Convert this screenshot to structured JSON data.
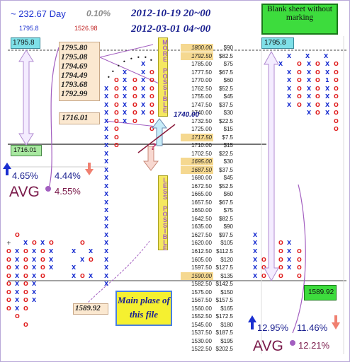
{
  "header": {
    "day_change": "~ 232.67 Day",
    "pct": "0.10%",
    "date1": "2012-10-19 20~00",
    "date2": "2012-03-01 04~00",
    "sub_left": "1795.8",
    "sub_mid": "1526.98",
    "blank_sheet": "Blank sheet without marking"
  },
  "left_panel": {
    "top_level": "1795.8",
    "mid_level": "1716.01",
    "pct_up": "4.65%",
    "pct_down": "4.44%",
    "avg_label": "AVG",
    "avg_value": "4.55%",
    "price_list": [
      "1795.80",
      "1795.08",
      "1794.69",
      "1794.49",
      "1793.68",
      "1792.99"
    ],
    "price_single": "1716.01",
    "low_price": "1589.92"
  },
  "center": {
    "more_possible": "MORE POSSIBLE",
    "less_possible": "LESS POSSIBLE",
    "current_price": "1740.00",
    "question_mark": "?",
    "main_place": "Main plase of this file"
  },
  "right_panel": {
    "top_level": "1795.8",
    "low_level": "1589.92",
    "pct_up": "12.95%",
    "pct_down": "11.46%",
    "avg_label": "AVG",
    "avg_value": "12.21%"
  },
  "colors": {
    "x_color": "#1a2fd0",
    "o_color": "#e02020",
    "highlight": "#f5d890",
    "cyan_box": "#7fe0e8",
    "green_box": "#3ddc3d",
    "purple": "#a35fc0"
  },
  "chart_data": {
    "type": "table",
    "levels": [
      {
        "price": "1800.00",
        "diff": "$90",
        "hl": true
      },
      {
        "price": "1792.50",
        "diff": "$82.5",
        "hl": true
      },
      {
        "price": "1785.00",
        "diff": "$75",
        "hl": false
      },
      {
        "price": "1777.50",
        "diff": "$67.5",
        "hl": false
      },
      {
        "price": "1770.00",
        "diff": "$60",
        "hl": false
      },
      {
        "price": "1762.50",
        "diff": "$52.5",
        "hl": false
      },
      {
        "price": "1755.00",
        "diff": "$45",
        "hl": false
      },
      {
        "price": "1747.50",
        "diff": "$37.5",
        "hl": false
      },
      {
        "price": "1740.00",
        "diff": "$30",
        "hl": false
      },
      {
        "price": "1732.50",
        "diff": "$22.5",
        "hl": false
      },
      {
        "price": "1725.00",
        "diff": "$15",
        "hl": false
      },
      {
        "price": "1717.50",
        "diff": "$7.5",
        "hl": true
      },
      {
        "price": "1710.00",
        "diff": "$15",
        "hl": false
      },
      {
        "price": "1702.50",
        "diff": "$22.5",
        "hl": false
      },
      {
        "price": "1695.00",
        "diff": "$30",
        "hl": true
      },
      {
        "price": "1687.50",
        "diff": "$37.5",
        "hl": true
      },
      {
        "price": "1680.00",
        "diff": "$45",
        "hl": false
      },
      {
        "price": "1672.50",
        "diff": "$52.5",
        "hl": false
      },
      {
        "price": "1665.00",
        "diff": "$60",
        "hl": false
      },
      {
        "price": "1657.50",
        "diff": "$67.5",
        "hl": false
      },
      {
        "price": "1650.00",
        "diff": "$75",
        "hl": false
      },
      {
        "price": "1642.50",
        "diff": "$82.5",
        "hl": false
      },
      {
        "price": "1635.00",
        "diff": "$90",
        "hl": false
      },
      {
        "price": "1627.50",
        "diff": "$97.5",
        "hl": false
      },
      {
        "price": "1620.00",
        "diff": "$105",
        "hl": false
      },
      {
        "price": "1612.50",
        "diff": "$112.5",
        "hl": false
      },
      {
        "price": "1605.00",
        "diff": "$120",
        "hl": false
      },
      {
        "price": "1597.50",
        "diff": "$127.5",
        "hl": false
      },
      {
        "price": "1590.00",
        "diff": "$135",
        "hl": true
      },
      {
        "price": "1582.50",
        "diff": "$142.5",
        "hl": false
      },
      {
        "price": "1575.00",
        "diff": "$150",
        "hl": false
      },
      {
        "price": "1567.50",
        "diff": "$157.5",
        "hl": false
      },
      {
        "price": "1560.00",
        "diff": "$165",
        "hl": false
      },
      {
        "price": "1552.50",
        "diff": "$172.5",
        "hl": false
      },
      {
        "price": "1545.00",
        "diff": "$180",
        "hl": false
      },
      {
        "price": "1537.50",
        "diff": "$187.5",
        "hl": false
      },
      {
        "price": "1530.00",
        "diff": "$195",
        "hl": false
      },
      {
        "price": "1522.50",
        "diff": "$202.5",
        "hl": false
      }
    ]
  }
}
